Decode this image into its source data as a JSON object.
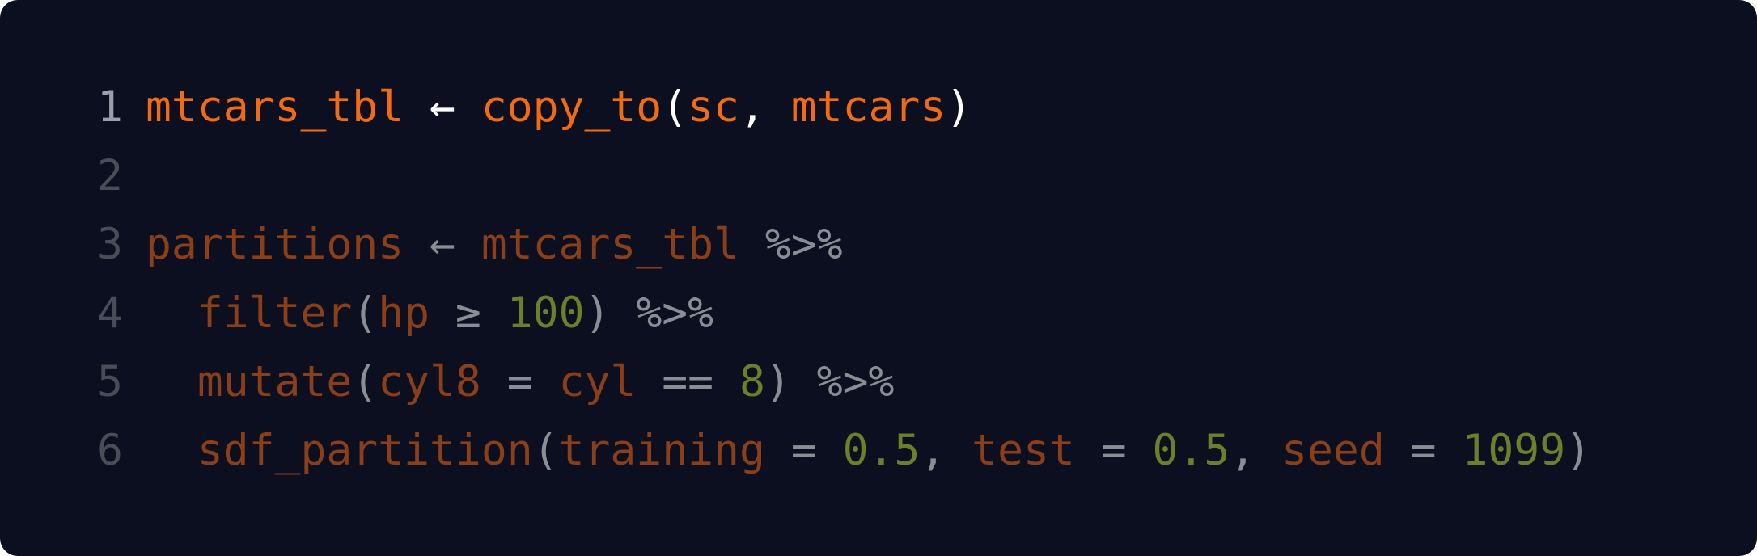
{
  "colors": {
    "background": "#0c0f1f",
    "line_number_active": "#9aa0ab",
    "line_number_dim": "#4a4d57",
    "highlight_identifier": "#f26b10",
    "highlight_punct": "#ffffff",
    "dim_identifier": "#8a3f18",
    "dim_operator": "#8b8d95",
    "dim_number": "#6b8028"
  },
  "lines": [
    {
      "number": "1",
      "highlighted": true,
      "tokens": [
        {
          "text": "mtcars_tbl",
          "kind": "ident"
        },
        {
          "text": " ← ",
          "kind": "punct"
        },
        {
          "text": "copy_to",
          "kind": "ident"
        },
        {
          "text": "(",
          "kind": "punct"
        },
        {
          "text": "sc",
          "kind": "ident"
        },
        {
          "text": ", ",
          "kind": "punct"
        },
        {
          "text": "mtcars",
          "kind": "ident"
        },
        {
          "text": ")",
          "kind": "punct"
        }
      ]
    },
    {
      "number": "2",
      "highlighted": false,
      "tokens": []
    },
    {
      "number": "3",
      "highlighted": false,
      "tokens": [
        {
          "text": "partitions",
          "kind": "ident"
        },
        {
          "text": " ← ",
          "kind": "op"
        },
        {
          "text": "mtcars_tbl",
          "kind": "ident"
        },
        {
          "text": " %>%",
          "kind": "op"
        }
      ]
    },
    {
      "number": "4",
      "highlighted": false,
      "tokens": [
        {
          "text": "  ",
          "kind": "op"
        },
        {
          "text": "filter",
          "kind": "ident"
        },
        {
          "text": "(",
          "kind": "op"
        },
        {
          "text": "hp",
          "kind": "ident"
        },
        {
          "text": " ≥ ",
          "kind": "op"
        },
        {
          "text": "100",
          "kind": "num"
        },
        {
          "text": ") %>%",
          "kind": "op"
        }
      ]
    },
    {
      "number": "5",
      "highlighted": false,
      "tokens": [
        {
          "text": "  ",
          "kind": "op"
        },
        {
          "text": "mutate",
          "kind": "ident"
        },
        {
          "text": "(",
          "kind": "op"
        },
        {
          "text": "cyl8",
          "kind": "ident"
        },
        {
          "text": " = ",
          "kind": "op"
        },
        {
          "text": "cyl",
          "kind": "ident"
        },
        {
          "text": " == ",
          "kind": "op"
        },
        {
          "text": "8",
          "kind": "num"
        },
        {
          "text": ") %>%",
          "kind": "op"
        }
      ]
    },
    {
      "number": "6",
      "highlighted": false,
      "tokens": [
        {
          "text": "  ",
          "kind": "op"
        },
        {
          "text": "sdf_partition",
          "kind": "ident"
        },
        {
          "text": "(",
          "kind": "op"
        },
        {
          "text": "training",
          "kind": "ident"
        },
        {
          "text": " = ",
          "kind": "op"
        },
        {
          "text": "0.5",
          "kind": "num"
        },
        {
          "text": ", ",
          "kind": "op"
        },
        {
          "text": "test",
          "kind": "ident"
        },
        {
          "text": " = ",
          "kind": "op"
        },
        {
          "text": "0.5",
          "kind": "num"
        },
        {
          "text": ", ",
          "kind": "op"
        },
        {
          "text": "seed",
          "kind": "ident"
        },
        {
          "text": " = ",
          "kind": "op"
        },
        {
          "text": "1099",
          "kind": "num"
        },
        {
          "text": ")",
          "kind": "op"
        }
      ]
    }
  ]
}
